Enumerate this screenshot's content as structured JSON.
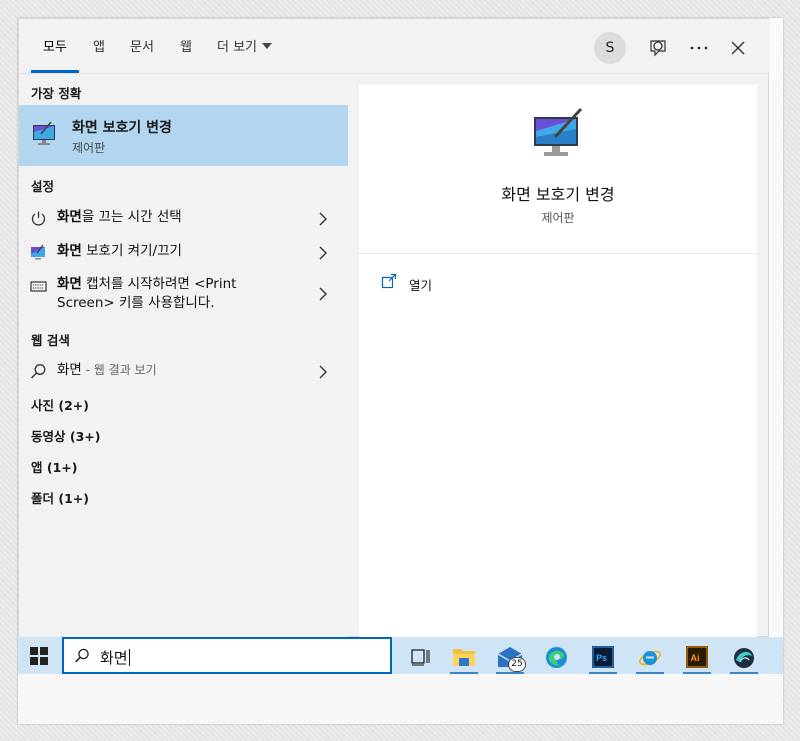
{
  "tabs": [
    {
      "label": "모두",
      "active": true
    },
    {
      "label": "앱"
    },
    {
      "label": "문서"
    },
    {
      "label": "웹"
    },
    {
      "label": "더 보기"
    }
  ],
  "account": {
    "initial": "S"
  },
  "left": {
    "best_match_title": "가장 정확",
    "best_match": {
      "title": "화면 보호기 변경",
      "subtitle": "제어판"
    },
    "settings_title": "설정",
    "settings": [
      {
        "bold": "화면",
        "rest": "을 끄는 시간 선택"
      },
      {
        "bold": "화면",
        "rest": " 보호기 켜기/끄기"
      },
      {
        "bold": "화면",
        "rest": " 캡처를 시작하려면 <Print",
        "line2": "Screen> 키를 사용합니다."
      }
    ],
    "web_title": "웹 검색",
    "web": {
      "term": "화면",
      "suffix": " - 웹 결과 보기"
    },
    "categories": [
      "사진 (2+)",
      "동영상 (3+)",
      "앱 (1+)",
      "폴더 (1+)"
    ]
  },
  "right": {
    "title": "화면 보호기 변경",
    "subtitle": "제어판",
    "open_label": "열기"
  },
  "taskbar": {
    "search_value": "화면",
    "mail_badge": "25",
    "apps": [
      "task-view",
      "file-explorer",
      "mail",
      "edge",
      "photoshop",
      "internet-explorer",
      "illustrator",
      "app-swirl"
    ]
  },
  "colors": {
    "accent": "#0067c0",
    "selection": "#b2d5f0",
    "taskbar": "#cfe4f5"
  }
}
